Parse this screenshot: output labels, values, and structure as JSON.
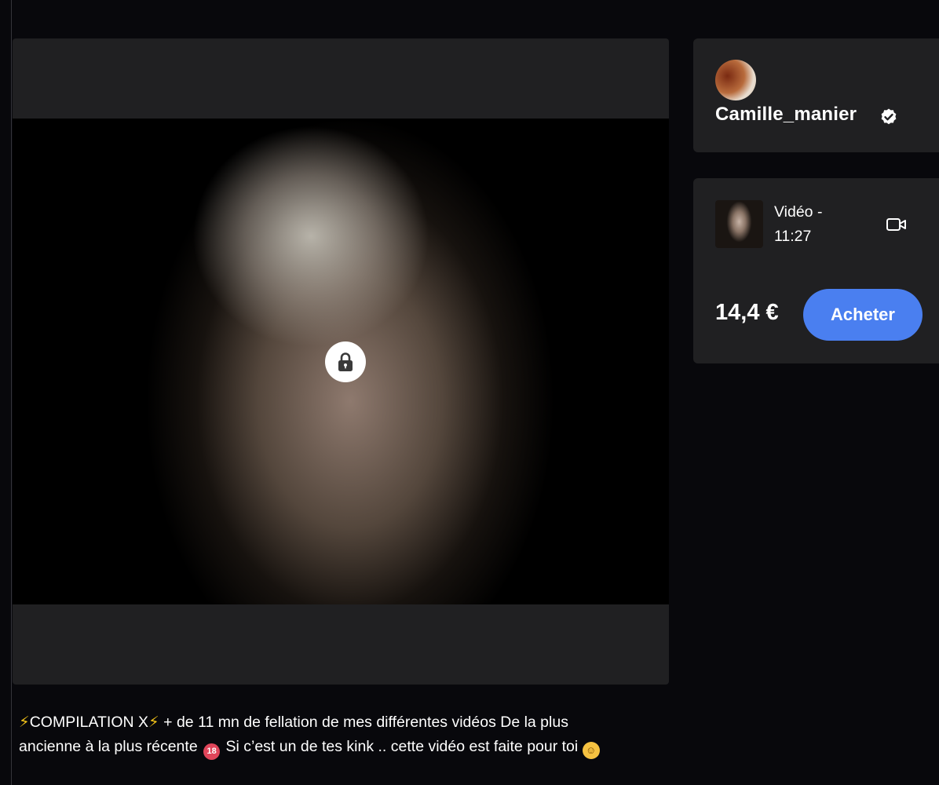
{
  "post": {
    "description": {
      "title_prefix_glyph": "⚡",
      "title": "COMPILATION X",
      "title_suffix_glyph": "⚡",
      "text_part1": " + de 11 mn de fellation de mes différentes vidéos De la plus ancienne à la plus récente ",
      "adult_badge": "18",
      "text_part2": " Si c’est un de tes kink .. cette vidéo est faite pour toi ",
      "emoji": "🤭"
    },
    "media": {
      "locked": true,
      "lock_icon": "lock-icon"
    }
  },
  "creator": {
    "name": "Camille_manier",
    "verified": true,
    "verified_icon": "verified-badge-icon"
  },
  "offer": {
    "media_type_label": "Vidéo -",
    "duration": "11:27",
    "media_type_icon": "video-camera-icon",
    "price": "14,4 €",
    "buy_label": "Acheter"
  },
  "colors": {
    "page_background": "#08080c",
    "card_background": "#202022",
    "accent": "#4a7ff0",
    "text": "#ffffff"
  }
}
